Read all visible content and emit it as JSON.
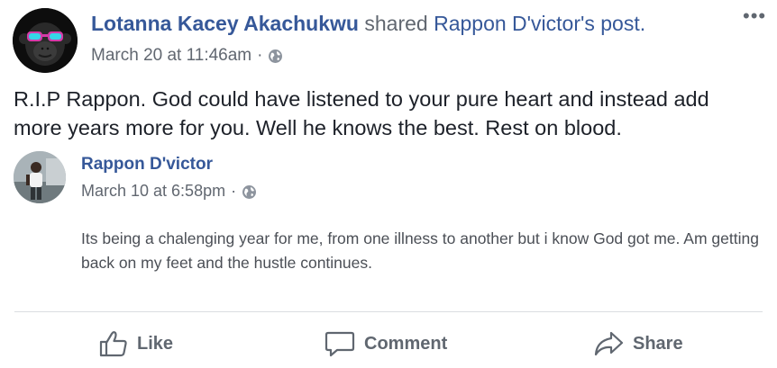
{
  "post": {
    "author": "Lotanna Kacey Akachukwu",
    "shared_text": " shared ",
    "shared_source": "Rappon D'victor's post.",
    "timestamp": "March 20 at 11:46am",
    "separator": "·",
    "more_label": "•••",
    "body": "R.I.P Rappon. God could have listened to your pure heart and instead add more years more for you. Well he knows the best. Rest on blood."
  },
  "shared_post": {
    "author": "Rappon D'victor",
    "timestamp": "March 10 at 6:58pm",
    "separator": "·",
    "body": "Its being a chalenging year for me, from one illness to another but i know God got me. Am getting back on my feet and the hustle continues."
  },
  "actions": {
    "like": "Like",
    "comment": "Comment",
    "share": "Share"
  },
  "icons": {
    "privacy": "globe-icon",
    "like": "thumbs-up-icon",
    "comment": "speech-bubble-icon",
    "share": "share-arrow-icon"
  },
  "colors": {
    "link": "#365899",
    "meta": "#616770",
    "text": "#1d2129",
    "action": "#606770"
  }
}
